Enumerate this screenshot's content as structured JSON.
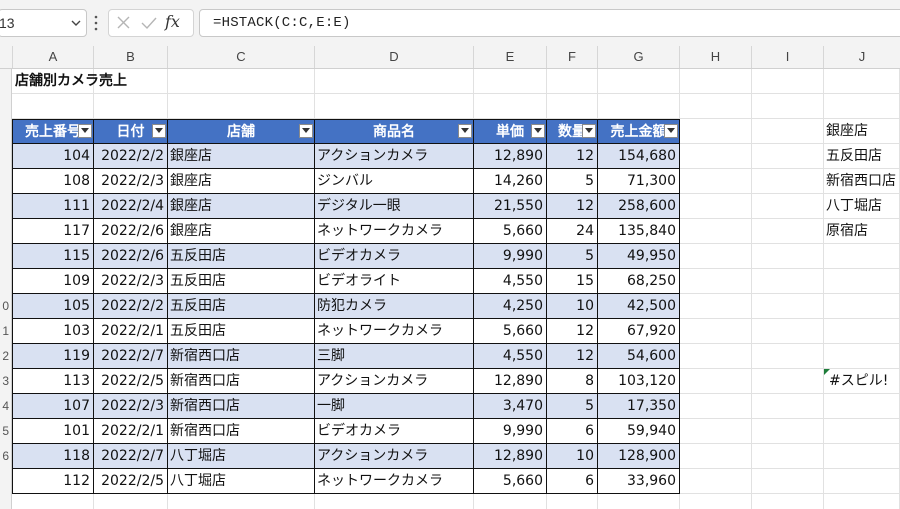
{
  "formula_bar": {
    "name_box": "13",
    "fx_label": "fx",
    "formula": "=HSTACK(C:C,E:E)"
  },
  "columns": [
    "A",
    "B",
    "C",
    "D",
    "E",
    "F",
    "G",
    "H",
    "I",
    "J"
  ],
  "row_numbers": [
    "",
    "",
    "",
    "",
    "",
    "",
    "",
    "",
    "",
    "0",
    "1",
    "2",
    "3",
    "4",
    "5",
    "6",
    ""
  ],
  "sheet_title": "店舗別カメラ売上",
  "table": {
    "headers": [
      "売上番号",
      "日付",
      "店舗",
      "商品名",
      "単価",
      "数量",
      "売上金額"
    ],
    "rows": [
      [
        "104",
        "2022/2/2",
        "銀座店",
        "アクションカメラ",
        "12,890",
        "12",
        "154,680"
      ],
      [
        "108",
        "2022/2/3",
        "銀座店",
        "ジンバル",
        "14,260",
        "5",
        "71,300"
      ],
      [
        "111",
        "2022/2/4",
        "銀座店",
        "デジタル一眼",
        "21,550",
        "12",
        "258,600"
      ],
      [
        "117",
        "2022/2/6",
        "銀座店",
        "ネットワークカメラ",
        "5,660",
        "24",
        "135,840"
      ],
      [
        "115",
        "2022/2/6",
        "五反田店",
        "ビデオカメラ",
        "9,990",
        "5",
        "49,950"
      ],
      [
        "109",
        "2022/2/3",
        "五反田店",
        "ビデオライト",
        "4,550",
        "15",
        "68,250"
      ],
      [
        "105",
        "2022/2/2",
        "五反田店",
        "防犯カメラ",
        "4,250",
        "10",
        "42,500"
      ],
      [
        "103",
        "2022/2/1",
        "五反田店",
        "ネットワークカメラ",
        "5,660",
        "12",
        "67,920"
      ],
      [
        "119",
        "2022/2/7",
        "新宿西口店",
        "三脚",
        "4,550",
        "12",
        "54,600"
      ],
      [
        "113",
        "2022/2/5",
        "新宿西口店",
        "アクションカメラ",
        "12,890",
        "8",
        "103,120"
      ],
      [
        "107",
        "2022/2/3",
        "新宿西口店",
        "一脚",
        "3,470",
        "5",
        "17,350"
      ],
      [
        "101",
        "2022/2/1",
        "新宿西口店",
        "ビデオカメラ",
        "9,990",
        "6",
        "59,940"
      ],
      [
        "118",
        "2022/2/7",
        "八丁堀店",
        "アクションカメラ",
        "12,890",
        "10",
        "128,900"
      ],
      [
        "112",
        "2022/2/5",
        "八丁堀店",
        "ネットワークカメラ",
        "5,660",
        "6",
        "33,960"
      ]
    ]
  },
  "store_list": [
    "銀座店",
    "五反田店",
    "新宿西口店",
    "八丁堀店",
    "原宿店"
  ],
  "spill_error": "#スピル!",
  "colors": {
    "header_fill": "#4472c4",
    "band_fill": "#d9e1f2",
    "error_indicator": "#1e7d3a"
  }
}
